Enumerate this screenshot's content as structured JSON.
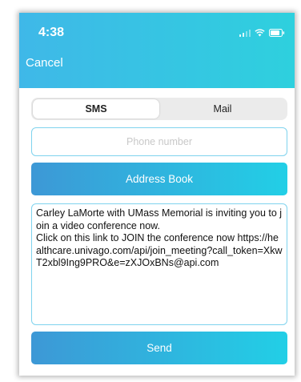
{
  "status_bar": {
    "time": "4:38",
    "icons": [
      "signal-icon",
      "wifi-icon",
      "battery-icon"
    ]
  },
  "nav": {
    "cancel_label": "Cancel"
  },
  "tabs": [
    {
      "label": "SMS",
      "selected": true
    },
    {
      "label": "Mail",
      "selected": false
    }
  ],
  "phone_field": {
    "value": "",
    "placeholder": "Phone number"
  },
  "address_book_label": "Address Book",
  "message": {
    "text": "Carley LaMorte with UMass Memorial is inviting you to join a video conference now.\nClick on this link to JOIN the conference now https://healthcare.univago.com/api/join_meeting?call_token=XkwT2xbl9Ing9PRO&e=zXJOxBNs@api.com"
  },
  "send_label": "Send",
  "colors": {
    "header_gradient_start": "#3fb8e8",
    "header_gradient_end": "#2ed0de",
    "button_gradient_start": "#3d98d6",
    "button_gradient_end": "#22cfe6",
    "field_border": "#7fd3ee"
  }
}
